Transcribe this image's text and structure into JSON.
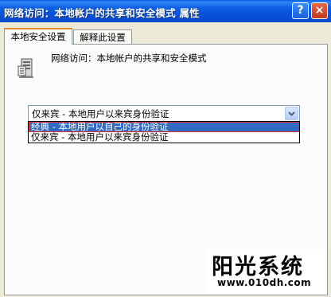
{
  "window": {
    "title": "网络访问：本地帐户的共享和安全模式 属性",
    "help_button": "?",
    "close_button": "×"
  },
  "tabs": [
    {
      "label": "本地安全设置",
      "active": true
    },
    {
      "label": "解释此设置",
      "active": false
    }
  ],
  "policy": {
    "icon": "server-policy-icon",
    "name": "网络访问：本地帐户的共享和安全模式"
  },
  "select": {
    "value": "仅来宾 - 本地用户以来宾身份验证",
    "options": [
      {
        "label": "经典 - 本地用户以自己的身份验证",
        "highlighted": true
      },
      {
        "label": "仅来宾 - 本地用户以来宾身份验证",
        "highlighted": false
      }
    ]
  },
  "watermark": {
    "title": "阳光系统",
    "url": "www.010dh.com"
  }
}
